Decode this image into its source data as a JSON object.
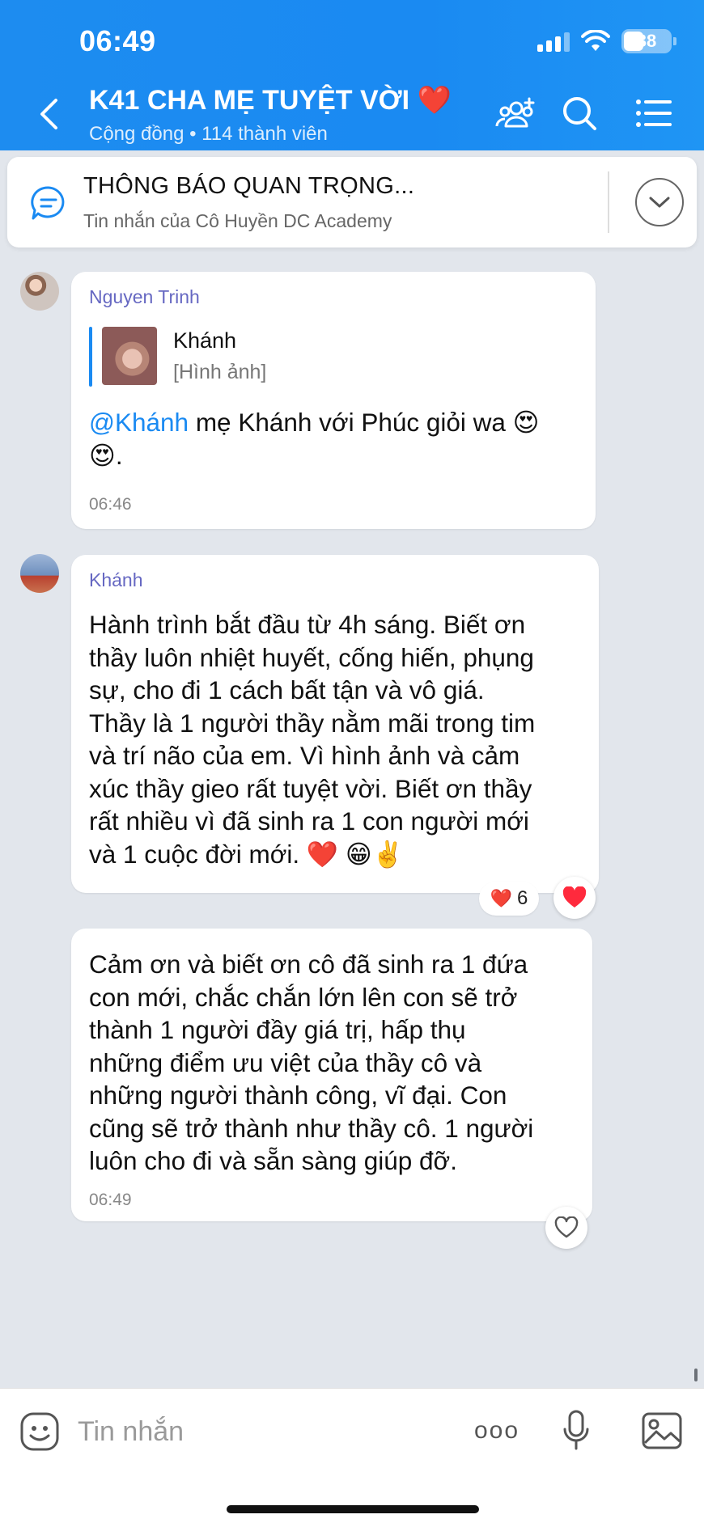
{
  "status_bar": {
    "time": "06:49",
    "battery": "38"
  },
  "header": {
    "title": "K41 CHA MẸ TUYỆT VỜI",
    "title_emoji": "❤️",
    "subtitle": "Cộng đồng • 114 thành viên"
  },
  "pinned": {
    "title": "THÔNG BÁO QUAN TRỌNG...",
    "subtitle": "Tin nhắn của Cô Huyền DC Academy"
  },
  "messages": [
    {
      "sender": "Nguyen Trinh",
      "quote": {
        "name": "Khánh",
        "type": "[Hình ảnh]"
      },
      "mention": "@Khánh",
      "text_line1": " mẹ Khánh với Phúc giỏi wa 😍",
      "text_line2": "😍.",
      "time": "06:46"
    },
    {
      "sender": "Khánh",
      "lines": [
        "Hành trình bắt đầu từ 4h sáng. Biết ơn",
        "thầy luôn nhiệt huyết, cống hiến, phụng",
        "sự, cho đi 1 cách bất tận và vô giá.",
        "Thầy là 1 người thầy nằm mãi trong tim",
        "và trí não của em. Vì hình ảnh và cảm",
        "xúc thầy gieo rất tuyệt vời. Biết ơn thầy",
        "rất nhiều vì đã sinh ra 1 con người mới",
        "và 1 cuộc đời mới. ❤️ 😁✌️"
      ],
      "reaction": {
        "emoji": "❤️",
        "count": "6"
      }
    },
    {
      "lines": [
        "Cảm ơn và biết ơn cô đã sinh ra 1 đứa",
        "con mới, chắc chắn lớn lên con sẽ trở",
        "thành 1 người đầy giá trị, hấp thụ",
        "những điểm ưu việt của thầy cô và",
        "những người thành công, vĩ đại. Con",
        "cũng sẽ trở thành như thầy cô. 1 người",
        "luôn cho đi và sẵn sàng giúp đỡ."
      ],
      "time": "06:49"
    }
  ],
  "input": {
    "placeholder": "Tin nhắn",
    "more_label": "ooo"
  },
  "colors": {
    "header_blue": "#1a8af2",
    "sender_purple": "#6668c2",
    "mention_blue": "#1a8af2",
    "heart_red": "#ff2a3d"
  },
  "icons": [
    "back-icon",
    "add-member-icon",
    "search-icon",
    "menu-icon",
    "pinned-message-icon",
    "chevron-down-icon",
    "heart-icon",
    "heart-outline-icon",
    "emoji-icon",
    "more-icon",
    "microphone-icon",
    "image-icon"
  ]
}
